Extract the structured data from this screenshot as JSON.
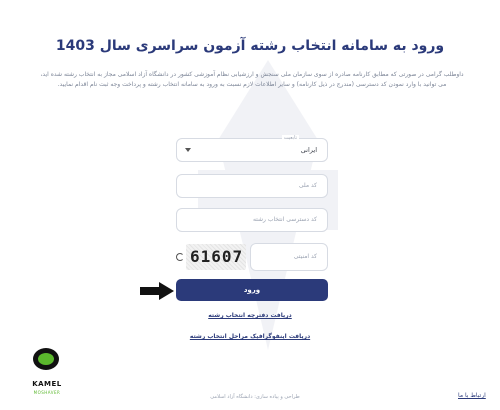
{
  "header": {
    "title": "ورود به سامانه انتخاب رشته آزمون سراسری سال 1403"
  },
  "intro": {
    "text": "داوطلب گرامی در صورتی که مطابق کارنامه صادره از سوی سازمان ملی سنجش و ارزشیابی نظام آموزشی کشور در دانشگاه آزاد اسلامی مجاز به انتخاب رشته شده اید، می توانید با وارد نمودن کد دسترسی (مندرج در ذیل کارنامه) و سایر اطلاعات لازم نسبت به ورود به سامانه انتخاب رشته و پرداخت وجه ثبت نام اقدام نمایید."
  },
  "form": {
    "nationality_caption": "تابعیت",
    "nationality_value": "ایرانی",
    "national_code_placeholder": "کد ملی",
    "access_code_placeholder": "کد دسترسی انتخاب رشته",
    "captcha_placeholder": "کد امنیتی",
    "captcha_text": "61607",
    "login_label": "ورود"
  },
  "links": {
    "guide_booklet": "دریافت دفترچه انتخاب رشته",
    "steps_infographic": "دریافت اینفوگرافیک مراحل انتخاب رشته",
    "contact_us": "ارتباط با ما"
  },
  "footer": {
    "text": "طراحی و پیاده سازی: دانشگاه آزاد اسلامی"
  },
  "branding": {
    "logo_name": "KAMEL",
    "logo_sub": "MOSHAVER",
    "watermark": "دانشگاه آزاد اسلامی"
  },
  "colors": {
    "primary": "#2b3a7a",
    "logo_green": "#5bb82d"
  }
}
